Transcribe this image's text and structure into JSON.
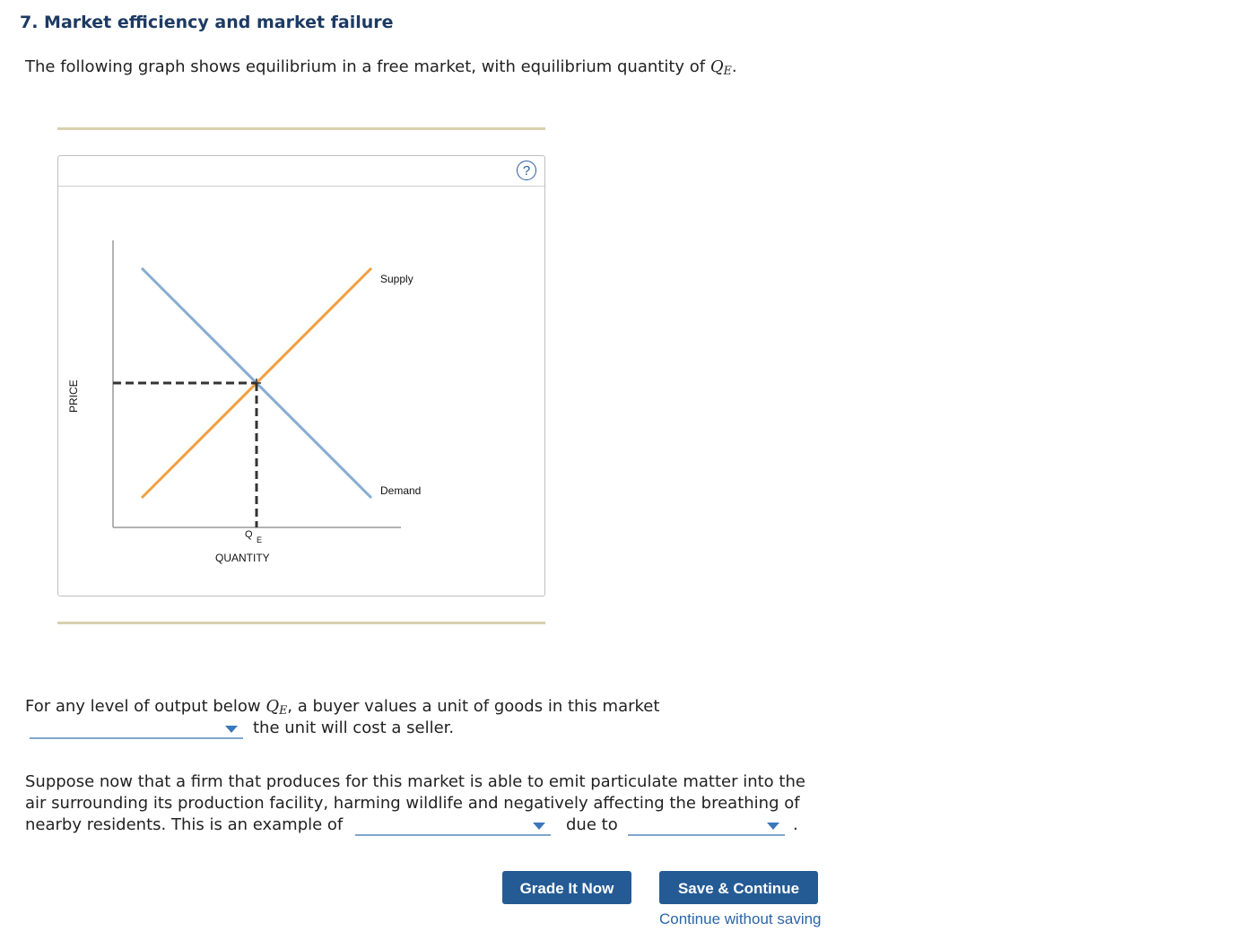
{
  "page": {
    "title": "7. Market efficiency and market failure",
    "intro_text": "The following graph shows equilibrium in a free market, with equilibrium quantity of",
    "intro_math": "Q",
    "intro_math_sub": "E",
    "intro_end": "."
  },
  "graph": {
    "help_symbol": "?",
    "y_axis_label": "PRICE",
    "x_axis_label": "QUANTITY",
    "qe_label": "Q",
    "qe_sub": "E",
    "supply_label": "Supply",
    "demand_label": "Demand",
    "colors": {
      "supply": "#f0a040",
      "demand": "#88acd0",
      "dashed": "#333333"
    }
  },
  "question1": {
    "before": "For any level of output below",
    "math": "Q",
    "math_sub": "E",
    "after": ", a buyer values a unit of goods in this market",
    "dropdown_value": "",
    "tail": "the unit will cost a seller."
  },
  "question2": {
    "line1": "Suppose now that a firm that produces for this market is able to emit particulate matter into the",
    "line2": "air surrounding its production facility, harming wildlife and negatively affecting the breathing of",
    "line3": "nearby residents. This is an example of",
    "dropdown1_value": "",
    "middle": "due to",
    "dropdown2_value": "",
    "end": "."
  },
  "buttons": {
    "grade": "Grade It Now",
    "save": "Save & Continue",
    "continue_link": "Continue without saving"
  }
}
